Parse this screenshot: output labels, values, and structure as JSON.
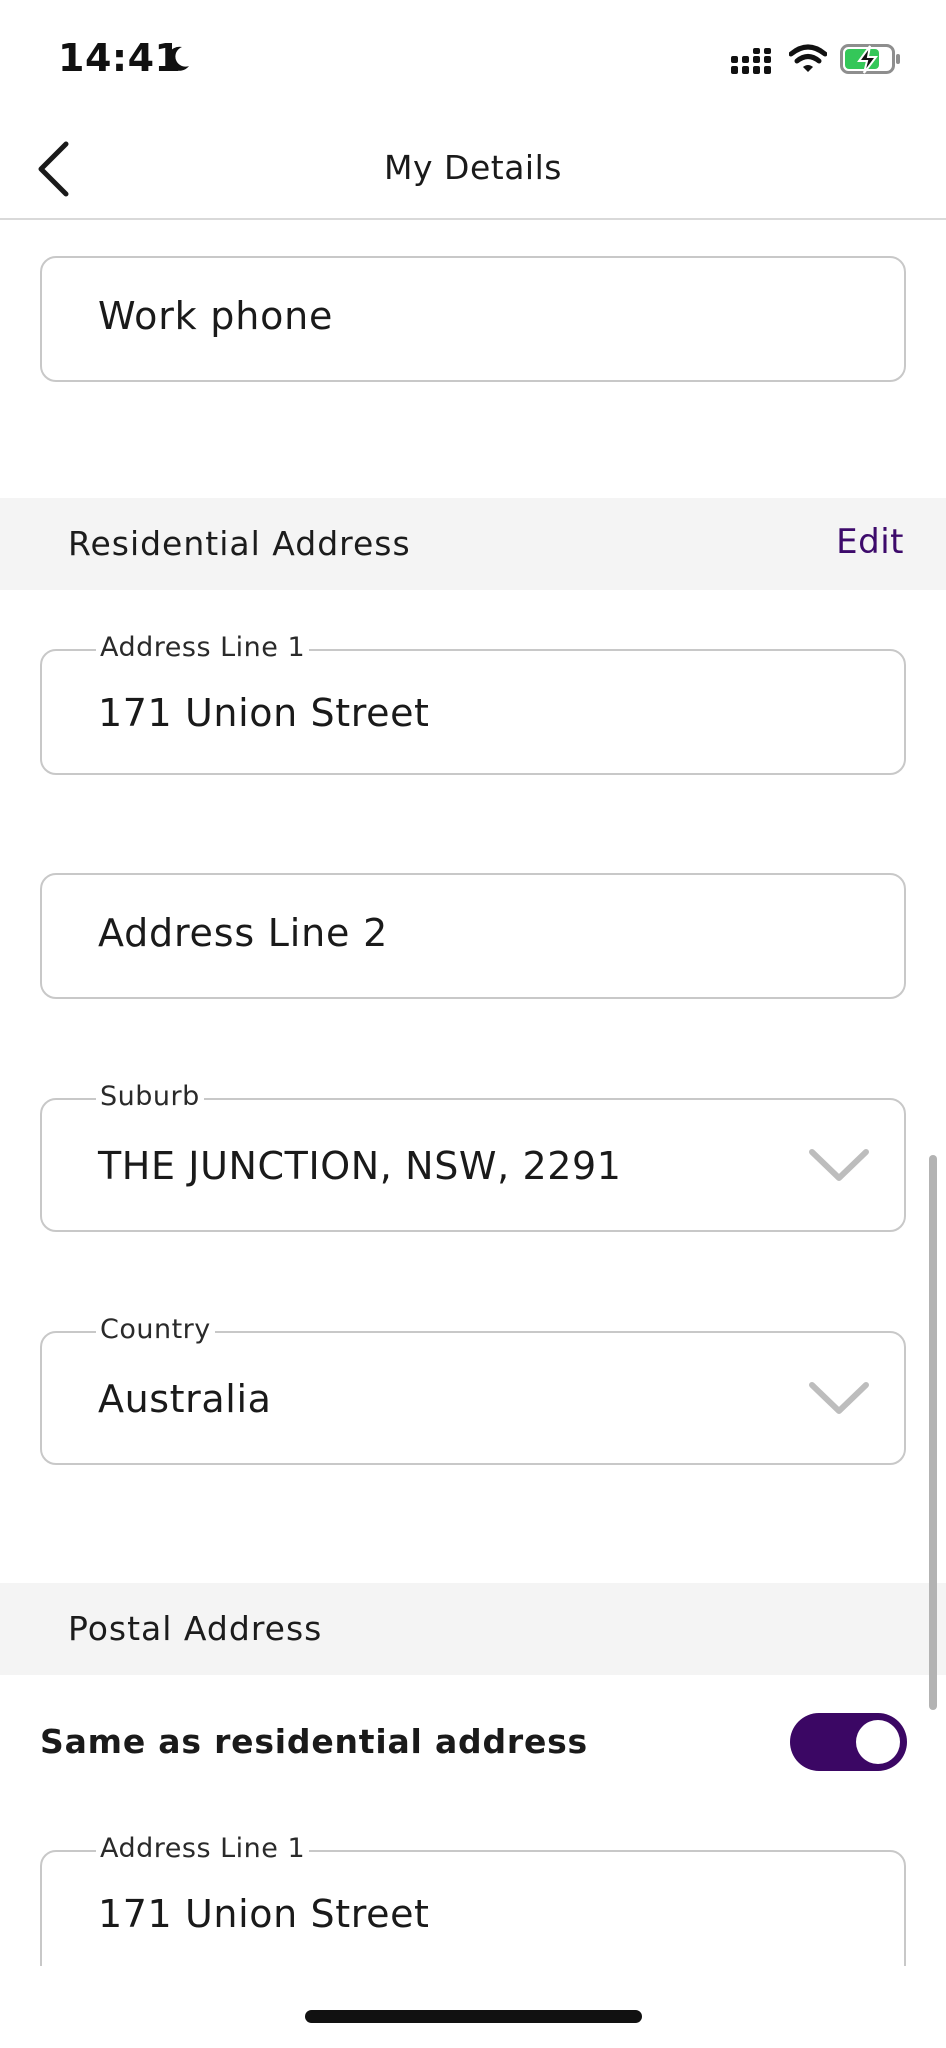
{
  "status_bar": {
    "time": "14:41",
    "icons": [
      "moon-icon",
      "cellular-signal-icon",
      "wifi-icon",
      "battery-charging-icon"
    ],
    "battery_color": "#34c759"
  },
  "nav": {
    "title": "My Details",
    "back_icon": "chevron-left-icon"
  },
  "contact": {
    "work_phone": {
      "placeholder": "Work phone"
    }
  },
  "residential": {
    "title": "Residential Address",
    "edit_label": "Edit",
    "address_line_1": {
      "label": "Address Line 1",
      "value": "171 Union Street"
    },
    "address_line_2": {
      "placeholder": "Address Line 2"
    },
    "suburb": {
      "label": "Suburb",
      "value": "THE JUNCTION, NSW, 2291"
    },
    "country": {
      "label": "Country",
      "value": "Australia"
    }
  },
  "postal": {
    "title": "Postal Address",
    "same_as_residential": {
      "label": "Same as residential address",
      "checked": true
    },
    "address_line_1": {
      "label": "Address Line 1",
      "value": "171 Union Street"
    }
  },
  "colors": {
    "accent": "#3b0764",
    "edit_link": "#3d0a6b",
    "section_band": "#f4f4f4",
    "field_border": "#c8c8c8"
  }
}
